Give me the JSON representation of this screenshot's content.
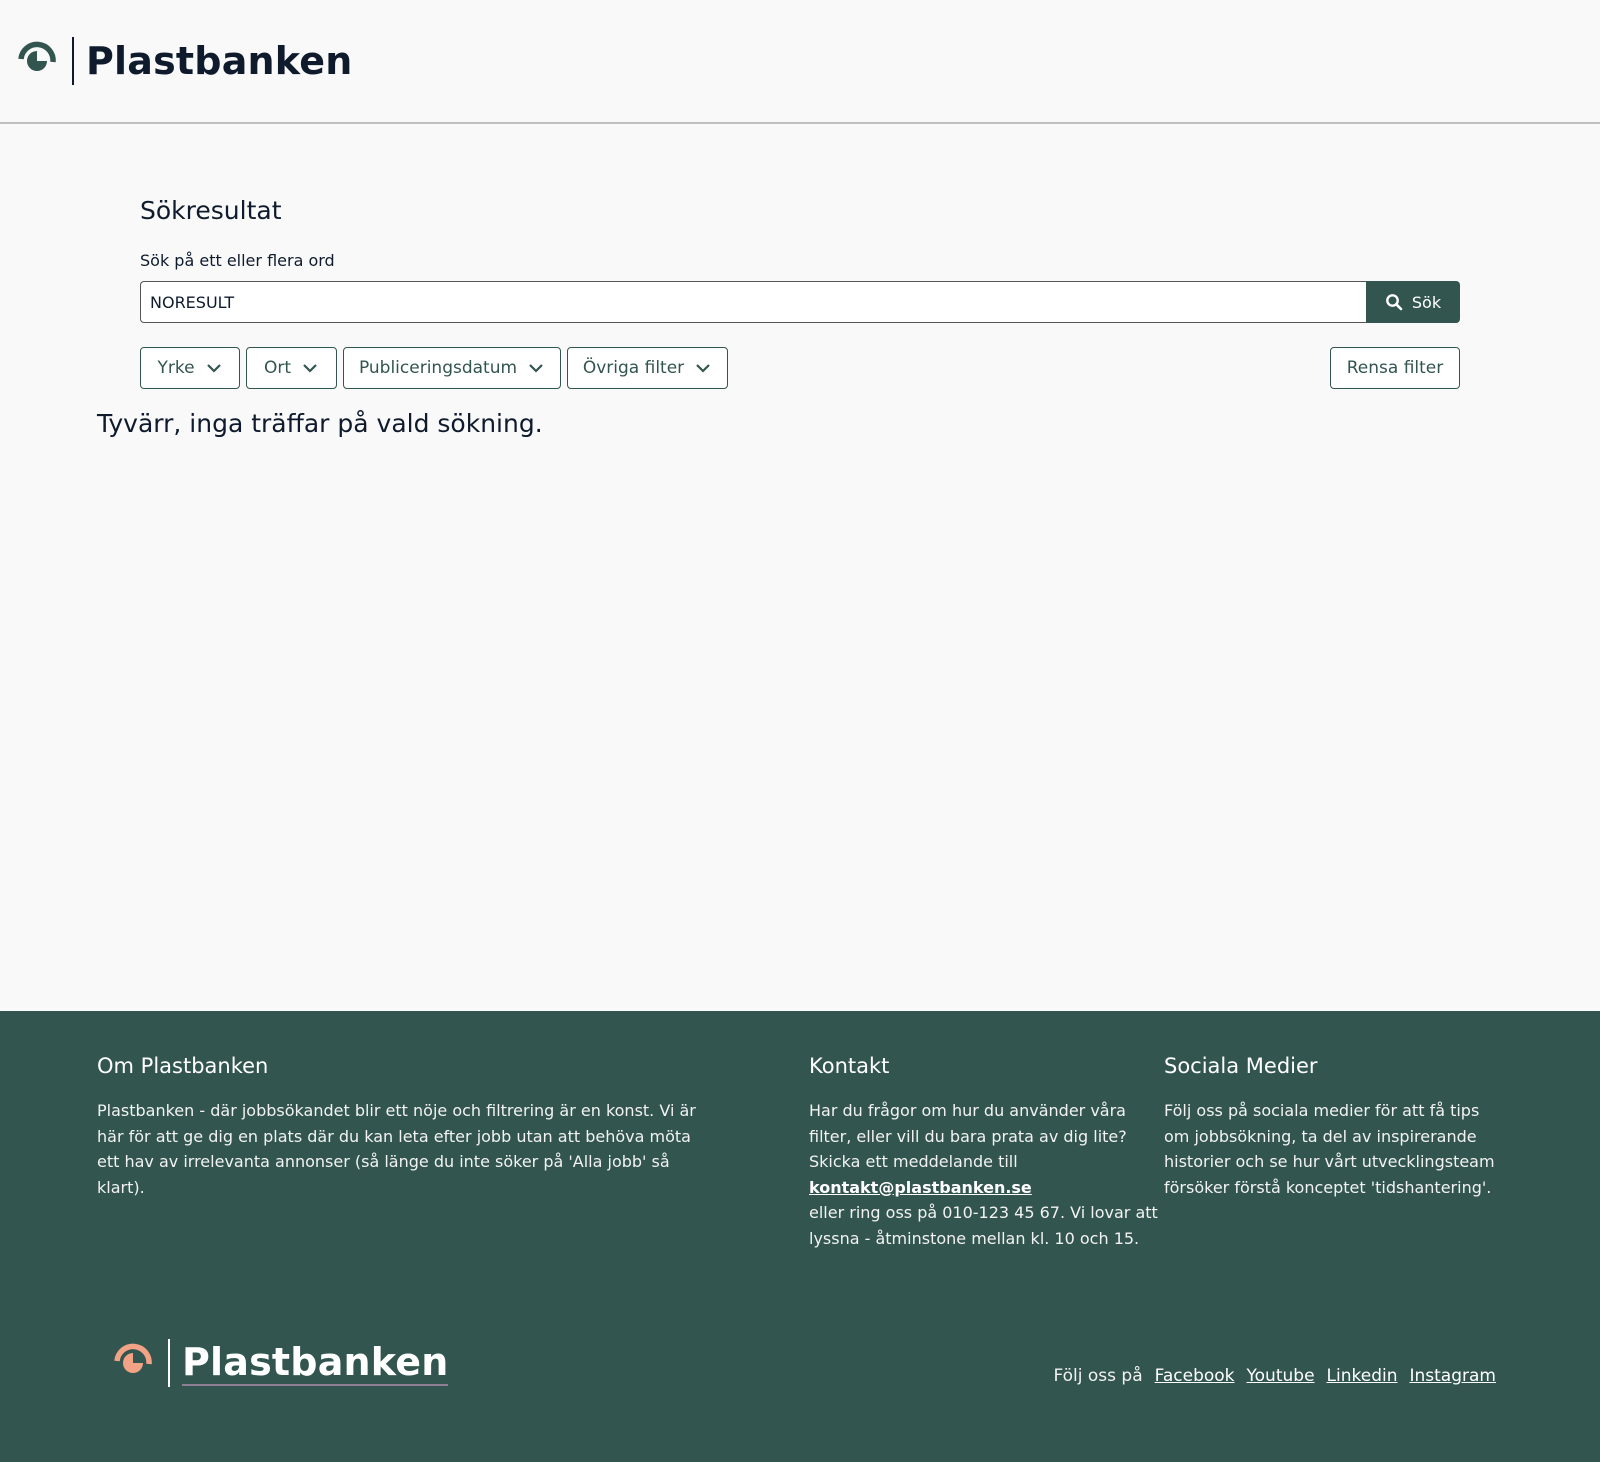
{
  "header": {
    "brand_name": "Plastbanken",
    "logo_icon": "plastbanken-swirl-icon"
  },
  "main": {
    "title": "Sökresultat",
    "search": {
      "label": "Sök på ett eller flera ord",
      "value": "NORESULT",
      "button_label": "Sök",
      "button_icon": "search-icon"
    },
    "filters": [
      {
        "label": "Yrke"
      },
      {
        "label": "Ort"
      },
      {
        "label": "Publiceringsdatum"
      },
      {
        "label": "Övriga filter"
      }
    ],
    "clear_filters_label": "Rensa filter",
    "no_results_text": "Tyvärr, inga träffar på vald sökning."
  },
  "footer": {
    "about": {
      "heading": "Om Plastbanken",
      "text": "Plastbanken - där jobbsökandet blir ett nöje och filtrering är en konst. Vi är här för att ge dig en plats där du kan leta efter jobb utan att behöva möta ett hav av irrelevanta annonser (så länge du inte söker på 'Alla jobb' så klart)."
    },
    "contact": {
      "heading": "Kontakt",
      "text_before": "Har du frågor om hur du använder våra filter, eller vill du bara prata av dig lite? Skicka ett meddelande till",
      "email": "kontakt@plastbanken.se",
      "text_after": "eller ring oss på 010-123 45 67. Vi lovar att lyssna - åtminstone mellan kl. 10 och 15."
    },
    "social": {
      "heading": "Sociala Medier",
      "text": "Följ oss på sociala medier för att få tips om jobbsökning, ta del av inspirerande historier och se hur vårt utvecklingsteam försöker förstå konceptet 'tidshantering'."
    },
    "brand_name": "Plastbanken",
    "follow_label": "Följ oss på",
    "links": [
      {
        "label": "Facebook"
      },
      {
        "label": "Youtube"
      },
      {
        "label": "Linkedin"
      },
      {
        "label": "Instagram"
      }
    ]
  },
  "colors": {
    "primary": "#32554f",
    "text": "#0f1b2d",
    "background": "#f9f9f9",
    "logo_top": "#32554f",
    "logo_bottom": "#f2a285"
  }
}
